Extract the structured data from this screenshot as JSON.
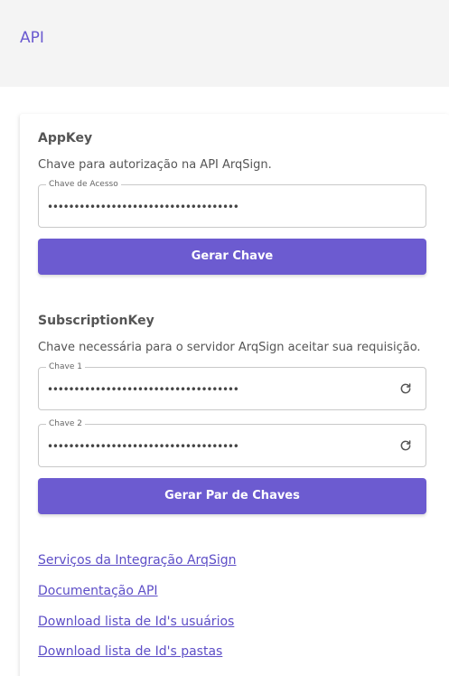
{
  "header": {
    "title": "API"
  },
  "appkey": {
    "title": "AppKey",
    "description": "Chave para autorização na API ArqSign.",
    "field_label": "Chave de Acesso",
    "field_value": "••••••••••••••••••••••••••••••••••••",
    "button_label": "Gerar Chave"
  },
  "subscription": {
    "title": "SubscriptionKey",
    "description": "Chave necessária para o servidor ArqSign aceitar sua requisição.",
    "key1_label": "Chave 1",
    "key1_value": "••••••••••••••••••••••••••••••••••••",
    "key2_label": "Chave 2",
    "key2_value": "••••••••••••••••••••••••••••••••••••",
    "refresh_icon": "refresh-icon",
    "button_label": "Gerar Par de Chaves"
  },
  "links": [
    {
      "label": "Serviços da Integração ArqSign"
    },
    {
      "label": "Documentação API"
    },
    {
      "label": "Download lista de Id's usuários"
    },
    {
      "label": "Download lista de Id's pastas"
    }
  ],
  "colors": {
    "accent": "#6c5bd0",
    "link": "#5d4ec7",
    "header_bg": "#f4f4f4"
  }
}
